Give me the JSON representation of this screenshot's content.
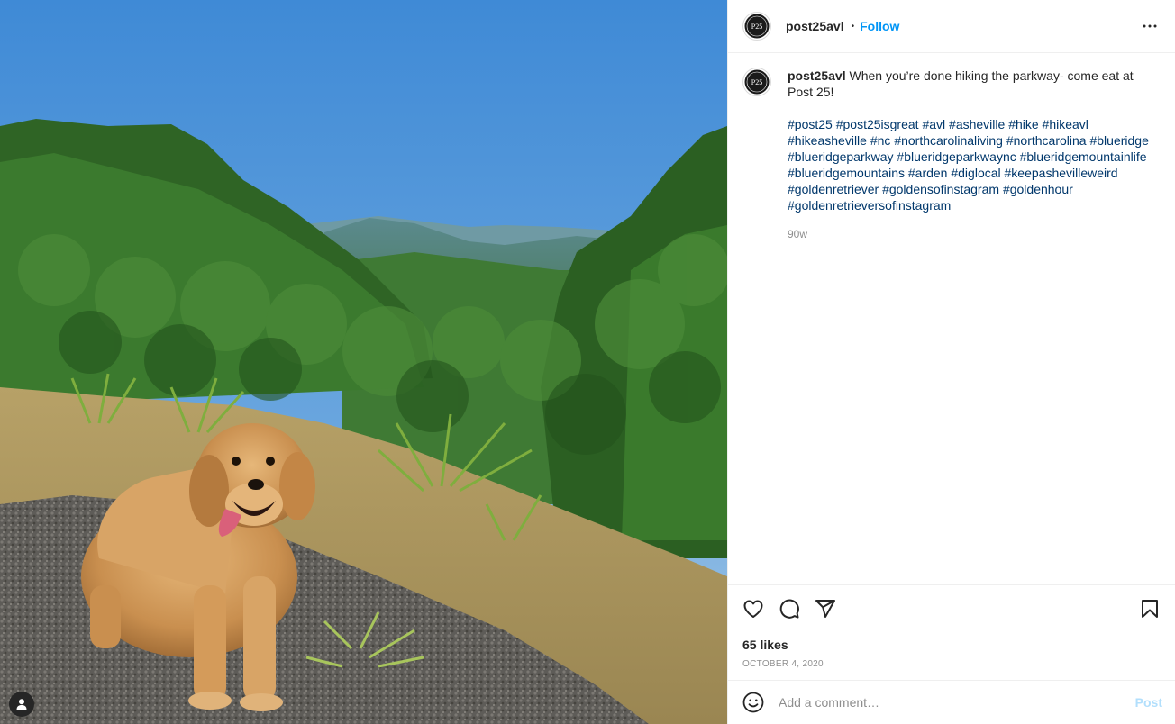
{
  "post": {
    "username": "post25avl",
    "follow_label": "Follow",
    "dot": "•",
    "avatar_monogram": "P25",
    "caption": {
      "username": "post25avl",
      "text": "When you’re done hiking the parkway- come eat at Post 25!",
      "hashtags": [
        "#post25",
        "#post25isgreat",
        "#avl",
        "#asheville",
        "#hike",
        "#hikeavl",
        "#hikeasheville",
        "#nc",
        "#northcarolinaliving",
        "#northcarolina",
        "#blueridge",
        "#blueridgeparkway",
        "#blueridgeparkwaync",
        "#blueridgemountainlife",
        "#blueridgemountains",
        "#arden",
        "#diglocal",
        "#keepashevilleweird",
        "#goldenretriever",
        "#goldensofinstagram",
        "#goldenhour",
        "#goldenretrieversofinstagram"
      ],
      "age": "90w"
    },
    "likes": "65 likes",
    "date": "OCTOBER 4, 2020",
    "comment_placeholder": "Add a comment…",
    "post_label": "Post"
  },
  "icons": {
    "more": "more-options-icon",
    "like": "heart-icon",
    "comment": "comment-icon",
    "share": "share-icon",
    "save": "bookmark-icon",
    "emoji": "emoji-icon",
    "tag": "user-tag-icon"
  },
  "colors": {
    "accent": "#0095f6",
    "hashtag": "#00376b",
    "muted": "#8e8e8e",
    "post_disabled": "#b2dffc"
  }
}
